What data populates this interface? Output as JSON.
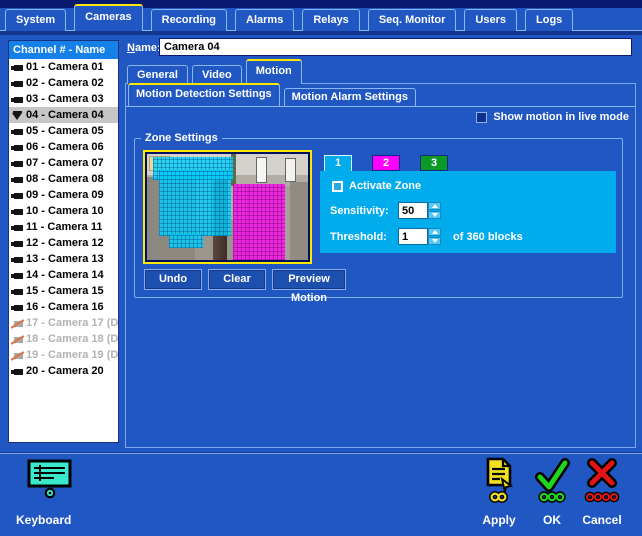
{
  "colors": {
    "background": "#2157c2",
    "top_strip_navy": "#0a1970",
    "accent_yellow": "#ffe800",
    "sidebar_header_blue": "#1480e8",
    "selected_row_gray": "#c6c6c6",
    "panel_cyan": "#00acec",
    "zone1_cyan": "#00acec",
    "zone2_magenta": "#ff00ff",
    "zone3_green": "#0a9a28",
    "apply_yellow": "#f2e020",
    "ok_green": "#1ed41e",
    "cancel_red": "#e41414",
    "keyboard_teal": "#3ae8cc"
  },
  "main_tabs": {
    "active_index": 1,
    "items": [
      "System",
      "Cameras",
      "Recording",
      "Alarms",
      "Relays",
      "Seq. Monitor",
      "Users",
      "Logs"
    ]
  },
  "sidebar": {
    "header": "Channel # - Name",
    "channels": [
      {
        "label": "01 - Camera 01",
        "state": "normal"
      },
      {
        "label": "02 - Camera 02",
        "state": "normal"
      },
      {
        "label": "03 - Camera 03",
        "state": "normal"
      },
      {
        "label": "04 - Camera 04",
        "state": "selected"
      },
      {
        "label": "05 - Camera 05",
        "state": "normal"
      },
      {
        "label": "06 - Camera 06",
        "state": "normal"
      },
      {
        "label": "07 - Camera 07",
        "state": "normal"
      },
      {
        "label": "08 - Camera 08",
        "state": "normal"
      },
      {
        "label": "09 - Camera 09",
        "state": "normal"
      },
      {
        "label": "10 - Camera 10",
        "state": "normal"
      },
      {
        "label": "11 - Camera 11",
        "state": "normal"
      },
      {
        "label": "12 - Camera 12",
        "state": "normal"
      },
      {
        "label": "13 - Camera 13",
        "state": "normal"
      },
      {
        "label": "14 - Camera 14",
        "state": "normal"
      },
      {
        "label": "15 - Camera 15",
        "state": "normal"
      },
      {
        "label": "16 - Camera 16",
        "state": "normal"
      },
      {
        "label": "17 - Camera 17 (D...",
        "state": "disabled"
      },
      {
        "label": "18 - Camera 18 (D...",
        "state": "disabled"
      },
      {
        "label": "19 - Camera 19 (D...",
        "state": "disabled"
      },
      {
        "label": "20 - Camera 20",
        "state": "normal"
      }
    ]
  },
  "name_field": {
    "label_mnemonic": "N",
    "label_rest": "ame:",
    "value": "Camera 04"
  },
  "camera_tabs": {
    "active_index": 2,
    "items": [
      "General",
      "Video",
      "Motion"
    ]
  },
  "motion_subtabs": {
    "active_index": 0,
    "items": [
      "Motion Detection Settings",
      "Motion Alarm Settings"
    ]
  },
  "show_motion": {
    "label": "Show motion in live mode",
    "checked": false
  },
  "zone_settings": {
    "group_label": "Zone Settings",
    "zones": [
      {
        "label": "1",
        "color": "#00acec",
        "selected": true
      },
      {
        "label": "2",
        "color": "#ff00ff",
        "selected": false
      },
      {
        "label": "3",
        "color": "#0a9a28",
        "selected": false
      }
    ],
    "activate_zone": {
      "label": "Activate Zone",
      "checked": false
    },
    "sensitivity": {
      "label": "Sensitivity:",
      "value": "50"
    },
    "threshold": {
      "label": "Threshold:",
      "value": "1",
      "suffix": "of 360 blocks"
    },
    "undo_label": "Undo",
    "clear_label": "Clear",
    "preview_label": "Preview Motion"
  },
  "footer": {
    "keyboard_label": "Keyboard",
    "apply_label": "Apply",
    "ok_label": "OK",
    "cancel_label": "Cancel"
  }
}
